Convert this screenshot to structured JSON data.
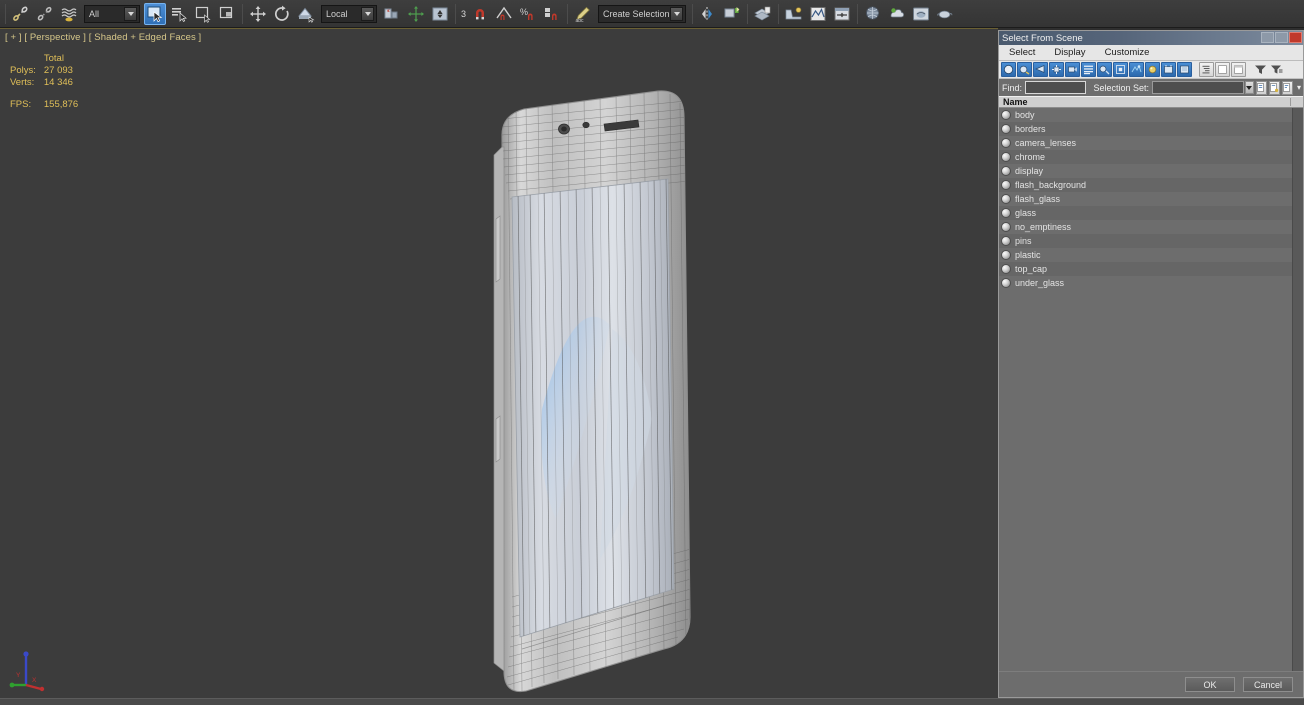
{
  "toolbar": {
    "groups": [
      {
        "icons": [
          {
            "name": "link-icon",
            "glyph": "link"
          },
          {
            "name": "unlink-icon",
            "glyph": "unlink"
          },
          {
            "name": "bind-to-space-warp-icon",
            "glyph": "wave"
          }
        ]
      },
      {
        "selection_filter": {
          "name": "selection-filter-combo",
          "value": "All"
        }
      },
      {
        "icons": [
          {
            "name": "select-object-icon",
            "glyph": "cursor",
            "active": true
          },
          {
            "name": "select-by-name-icon",
            "glyph": "list-cursor"
          },
          {
            "name": "rectangular-selection-region-icon",
            "glyph": "rect"
          },
          {
            "name": "window-crossing-icon",
            "glyph": "rect-fill"
          }
        ]
      },
      {
        "icons": [
          {
            "name": "select-and-move-icon",
            "glyph": "move"
          },
          {
            "name": "select-and-rotate-icon",
            "glyph": "rotate"
          },
          {
            "name": "select-and-scale-icon",
            "glyph": "scale"
          }
        ]
      },
      {
        "ref_coord_system": {
          "name": "reference-coordinate-system-combo",
          "value": "Local"
        }
      },
      {
        "icons": [
          {
            "name": "use-pivot-point-center-icon",
            "glyph": "pivot"
          },
          {
            "name": "select-and-manipulate-icon",
            "glyph": "manip"
          },
          {
            "name": "snaps-toggle-icon",
            "glyph": "snap"
          }
        ]
      },
      {
        "snap_level": "3",
        "icons": [
          {
            "name": "snap-toggle-icon",
            "glyph": "magnet3"
          },
          {
            "name": "angle-snap-toggle-icon",
            "glyph": "anglesnap"
          },
          {
            "name": "percent-snap-toggle-icon",
            "glyph": "percentsnap"
          },
          {
            "name": "spinner-snap-toggle-icon",
            "glyph": "spinnersnap"
          }
        ]
      },
      {
        "icons": [
          {
            "name": "edit-named-selection-sets-icon",
            "glyph": "namedsel"
          }
        ],
        "selection_set": {
          "name": "create-selection-set-combo",
          "value": "Create Selection Se"
        }
      },
      {
        "icons": [
          {
            "name": "mirror-icon",
            "glyph": "mirror"
          },
          {
            "name": "align-icon",
            "glyph": "align"
          }
        ]
      },
      {
        "icons": [
          {
            "name": "layer-explorer-icon",
            "glyph": "layers"
          }
        ]
      },
      {
        "icons": [
          {
            "name": "curve-editor-icon",
            "glyph": "curve"
          },
          {
            "name": "schematic-view-icon",
            "glyph": "schematic"
          },
          {
            "name": "track-view-icon",
            "glyph": "trackview"
          }
        ]
      },
      {
        "icons": [
          {
            "name": "material-editor-icon",
            "glyph": "sphere"
          },
          {
            "name": "render-setup-icon",
            "glyph": "teapot-render"
          },
          {
            "name": "rendered-frame-window-icon",
            "glyph": "frame"
          },
          {
            "name": "render-production-icon",
            "glyph": "teapot"
          }
        ]
      }
    ]
  },
  "viewport": {
    "label": "[ + ] [ Perspective ] [ Shaded + Edged Faces ]",
    "stats": {
      "total_header": "Total",
      "rows": [
        {
          "label": "Polys:",
          "value": "27 093"
        },
        {
          "label": "Verts:",
          "value": "14 346"
        }
      ],
      "fps_label": "FPS:",
      "fps_value": "155,876"
    },
    "axis_gizmo": {
      "x_label": "X",
      "y_label": "Y",
      "z_label": "Z",
      "x_color": "#2fa02f",
      "y_color": "#c03030",
      "z_color": "#3a49c8"
    },
    "model": {
      "name": "smartphone-wireframe-model",
      "body_color": "#c9c9c9",
      "screen_color": "#cdd3dc",
      "wallpaper_accent": "#9dc0e8"
    },
    "background_color": "#3c3c3c"
  },
  "dialog": {
    "title": "Select From Scene",
    "titlebar_buttons": [
      {
        "name": "minimize-button",
        "glyph": "minimize"
      },
      {
        "name": "maximize-button",
        "glyph": "maximize"
      },
      {
        "name": "close-button",
        "glyph": "close"
      }
    ],
    "menus": [
      "Select",
      "Display",
      "Customize"
    ],
    "toolbar_icons": [
      {
        "name": "display-all-icon",
        "style": "blue"
      },
      {
        "name": "display-geometry-icon",
        "style": "blue"
      },
      {
        "name": "display-shapes-icon",
        "style": "blue"
      },
      {
        "name": "display-lights-icon",
        "style": "blue"
      },
      {
        "name": "display-cameras-icon",
        "style": "blue"
      },
      {
        "name": "display-helpers-icon",
        "style": "blue"
      },
      {
        "name": "display-space-warps-icon",
        "style": "blue"
      },
      {
        "name": "display-groups-icon",
        "style": "blue"
      },
      {
        "name": "display-xrefs-icon",
        "style": "blue"
      },
      {
        "name": "display-bones-icon",
        "style": "blue"
      },
      {
        "name": "display-containers-icon",
        "style": "blue"
      },
      {
        "name": "display-frozen-icon",
        "style": "blue"
      },
      {
        "name": "display-children-icon",
        "style": "grey"
      },
      {
        "name": "display-influences-icon",
        "style": "grey"
      },
      {
        "name": "expand-all-icon",
        "style": "grey"
      },
      {
        "name": "filter-icon",
        "style": "plain"
      },
      {
        "name": "filter-selected-icon",
        "style": "plain"
      }
    ],
    "find": {
      "label": "Find:",
      "value": "",
      "placeholder": ""
    },
    "selection_set": {
      "label": "Selection Set:",
      "value": "",
      "placeholder": ""
    },
    "side_buttons": [
      {
        "name": "select-none-button"
      },
      {
        "name": "select-invert-button"
      },
      {
        "name": "select-children-button"
      }
    ],
    "column_header": "Name",
    "items": [
      {
        "name": "body"
      },
      {
        "name": "borders"
      },
      {
        "name": "camera_lenses"
      },
      {
        "name": "chrome"
      },
      {
        "name": "display"
      },
      {
        "name": "flash_background"
      },
      {
        "name": "flash_glass"
      },
      {
        "name": "glass"
      },
      {
        "name": "no_emptiness"
      },
      {
        "name": "pins"
      },
      {
        "name": "plastic"
      },
      {
        "name": "top_cap"
      },
      {
        "name": "under_glass"
      }
    ],
    "buttons": {
      "ok": "OK",
      "cancel": "Cancel"
    }
  }
}
